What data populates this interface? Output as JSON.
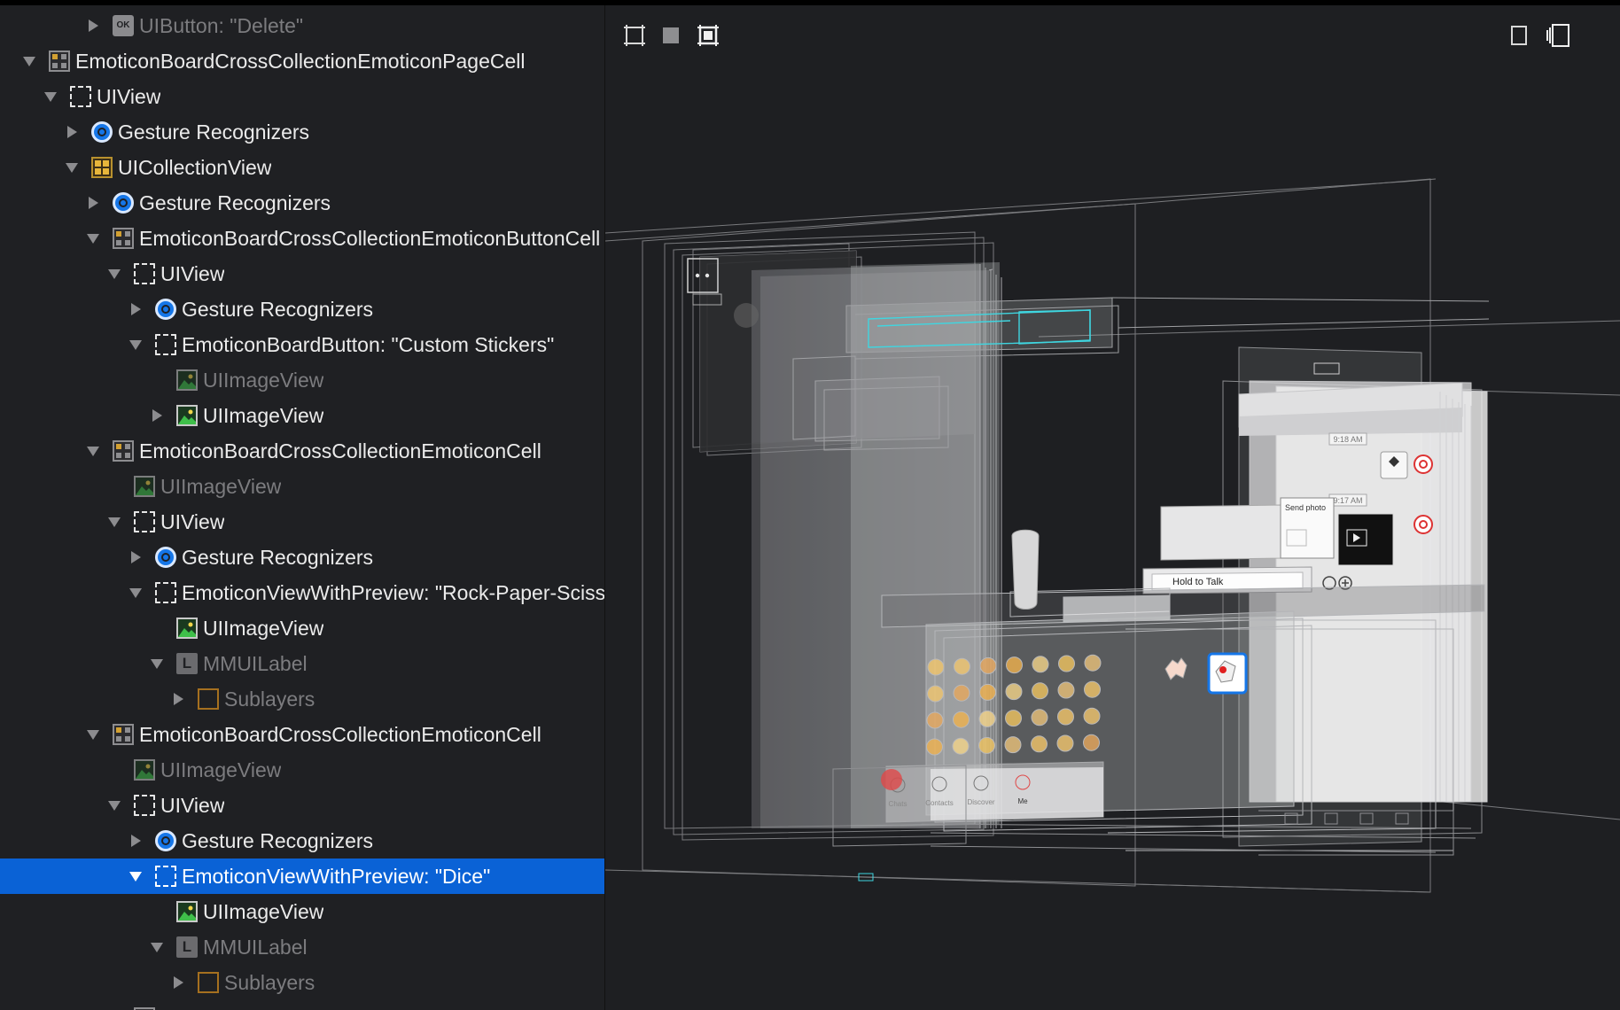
{
  "outline": {
    "rows": [
      {
        "label": "UIButton: \"Delete\"",
        "icon": "button-icon",
        "indent": 4,
        "expander": "collapsed",
        "dim": true
      },
      {
        "label": "EmoticonBoardCrossCollectionEmoticonPageCell",
        "icon": "cell-icon",
        "indent": 1,
        "expander": "expanded"
      },
      {
        "label": "UIView",
        "icon": "view-icon",
        "indent": 2,
        "expander": "expanded"
      },
      {
        "label": "Gesture Recognizers",
        "icon": "gesture-icon",
        "indent": 3,
        "expander": "collapsed"
      },
      {
        "label": "UICollectionView",
        "icon": "collection-icon",
        "indent": 3,
        "expander": "expanded"
      },
      {
        "label": "Gesture Recognizers",
        "icon": "gesture-icon",
        "indent": 4,
        "expander": "collapsed"
      },
      {
        "label": "EmoticonBoardCrossCollectionEmoticonButtonCell",
        "icon": "cell-icon",
        "indent": 4,
        "expander": "expanded"
      },
      {
        "label": "UIView",
        "icon": "view-icon",
        "indent": 5,
        "expander": "expanded"
      },
      {
        "label": "Gesture Recognizers",
        "icon": "gesture-icon",
        "indent": 6,
        "expander": "collapsed"
      },
      {
        "label": "EmoticonBoardButton: \"Custom Stickers\"",
        "icon": "view-icon",
        "indent": 6,
        "expander": "expanded"
      },
      {
        "label": "UIImageView",
        "icon": "image-icon",
        "indent": 7,
        "expander": "none",
        "dim": true
      },
      {
        "label": "UIImageView",
        "icon": "image-icon",
        "indent": 7,
        "expander": "collapsed"
      },
      {
        "label": "EmoticonBoardCrossCollectionEmoticonCell",
        "icon": "cell-icon",
        "indent": 4,
        "expander": "expanded"
      },
      {
        "label": "UIImageView",
        "icon": "image-icon",
        "indent": 5,
        "expander": "none",
        "dim": true
      },
      {
        "label": "UIView",
        "icon": "view-icon",
        "indent": 5,
        "expander": "expanded"
      },
      {
        "label": "Gesture Recognizers",
        "icon": "gesture-icon",
        "indent": 6,
        "expander": "collapsed"
      },
      {
        "label": "EmoticonViewWithPreview: \"Rock-Paper-Scissors\"",
        "icon": "view-icon",
        "indent": 6,
        "expander": "expanded"
      },
      {
        "label": "UIImageView",
        "icon": "image-icon",
        "indent": 7,
        "expander": "none"
      },
      {
        "label": "MMUILabel",
        "icon": "label-icon",
        "indent": 7,
        "expander": "expanded",
        "dim": true
      },
      {
        "label": "Sublayers",
        "icon": "sublayers-icon",
        "indent": 8,
        "expander": "collapsed",
        "dim": true
      },
      {
        "label": "EmoticonBoardCrossCollectionEmoticonCell",
        "icon": "cell-icon",
        "indent": 4,
        "expander": "expanded"
      },
      {
        "label": "UIImageView",
        "icon": "image-icon",
        "indent": 5,
        "expander": "none",
        "dim": true
      },
      {
        "label": "UIView",
        "icon": "view-icon",
        "indent": 5,
        "expander": "expanded"
      },
      {
        "label": "Gesture Recognizers",
        "icon": "gesture-icon",
        "indent": 6,
        "expander": "collapsed"
      },
      {
        "label": "EmoticonViewWithPreview: \"Dice\"",
        "icon": "view-icon",
        "indent": 6,
        "expander": "expanded",
        "selected": true
      },
      {
        "label": "UIImageView",
        "icon": "image-icon",
        "indent": 7,
        "expander": "none"
      },
      {
        "label": "MMUILabel",
        "icon": "label-icon",
        "indent": 7,
        "expander": "expanded",
        "dim": true
      },
      {
        "label": "Sublayers",
        "icon": "sublayers-icon",
        "indent": 8,
        "expander": "collapsed",
        "dim": true
      },
      {
        "label": "",
        "icon": "cell-icon",
        "indent": 5,
        "expander": "none"
      }
    ]
  },
  "toolbar": {
    "left_tools": [
      "wireframes-icon",
      "contents-icon",
      "wireframes-and-contents-icon"
    ],
    "right_tools": [
      "single-view-icon",
      "layer-stack-icon"
    ]
  },
  "canvas": {
    "time_label_1": "9:18 AM",
    "time_label_2": "9:17 AM",
    "send_label": "Send photo",
    "hold_to_talk": "Hold to Talk",
    "tabs": [
      "Chats",
      "Contacts",
      "Discover",
      "Me"
    ],
    "accent": "#1576e8",
    "selection": "#0a62d6",
    "highlight_cyan": "#3fd6e0"
  }
}
